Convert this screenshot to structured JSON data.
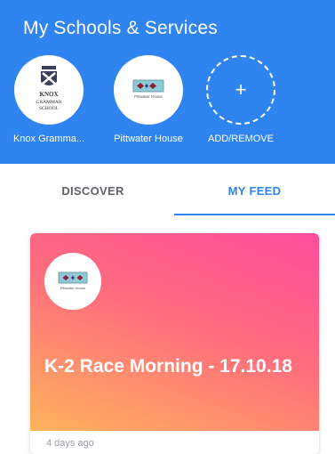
{
  "header": {
    "title": "My Schools & Services",
    "background": "#2f84f0"
  },
  "schools": [
    {
      "label": "Knox Gramma...",
      "logo_text_line1": "KNOX",
      "logo_text_line2": "GRAMMAR",
      "logo_text_line3": "SCHOOL"
    },
    {
      "label": "Pittwater House",
      "logo_text": "Pittwater House"
    }
  ],
  "add_remove": {
    "label": "ADD/REMOVE",
    "icon": "plus-icon"
  },
  "tabs": [
    {
      "label": "DISCOVER",
      "active": false
    },
    {
      "label": "MY FEED",
      "active": true
    }
  ],
  "feed": {
    "cards": [
      {
        "title": "K-2 Race Morning - 17.10.18",
        "time": "4 days ago",
        "school_logo_text": "Pittwater House"
      }
    ]
  },
  "colors": {
    "accent": "#2f84f0",
    "card_gradient_start": "#ff4d9c",
    "card_gradient_end": "#ffb35c",
    "tab_inactive": "#5f6368"
  }
}
